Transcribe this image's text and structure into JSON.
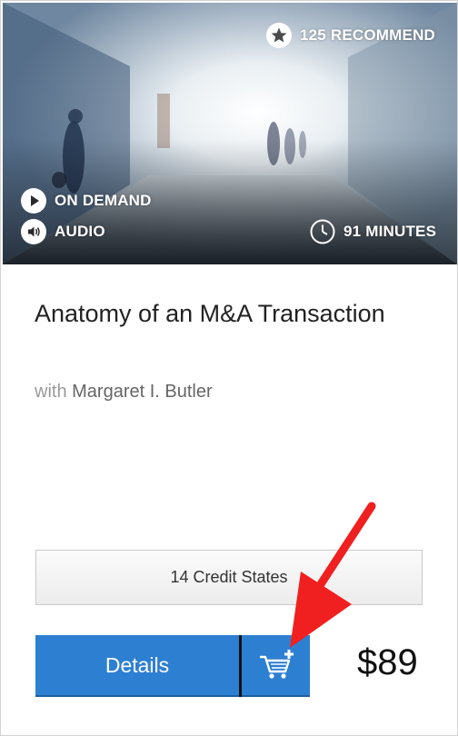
{
  "hero": {
    "recommend_text": "125 RECOMMEND",
    "format_text": "ON DEMAND",
    "media_text": "AUDIO",
    "duration_text": "91 MINUTES"
  },
  "course": {
    "title": "Anatomy of an M&A Transaction",
    "with_prefix": "with",
    "presenter": "Margaret I. Butler"
  },
  "actions": {
    "credit_states_label": "14 Credit States",
    "details_label": "Details",
    "price": "$89"
  },
  "icons": {
    "recommend": "star-icon",
    "format": "play-icon",
    "media": "speaker-icon",
    "duration": "clock-icon",
    "cart": "cart-plus-icon",
    "annotation": "red-arrow-icon"
  },
  "colors": {
    "button_blue": "#2d7fd2",
    "annotation_red": "#f02020"
  }
}
